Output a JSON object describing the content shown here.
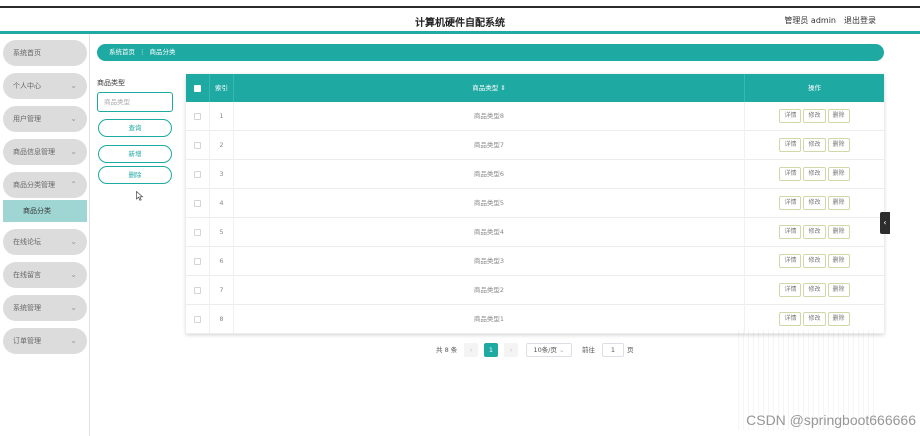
{
  "header": {
    "title": "计算机硬件自配系统",
    "user": "管理员 admin",
    "logout": "退出登录"
  },
  "sidebar": {
    "items": [
      {
        "label": "系统首页",
        "chev": ""
      },
      {
        "label": "个人中心",
        "chev": "⌄"
      },
      {
        "label": "用户管理",
        "chev": "⌄"
      },
      {
        "label": "商品信息管理",
        "chev": "⌄"
      },
      {
        "label": "商品分类管理",
        "chev": "⌃"
      },
      {
        "label": "在线论坛",
        "chev": "⌄"
      },
      {
        "label": "在线留言",
        "chev": "⌄"
      },
      {
        "label": "系统管理",
        "chev": "⌄"
      },
      {
        "label": "订单管理",
        "chev": "⌄"
      }
    ],
    "sub_active": "商品分类"
  },
  "breadcrumb": {
    "home": "系统首页",
    "sep": "⋮",
    "current": "商品分类"
  },
  "search": {
    "label": "商品类型",
    "placeholder": "商品类型",
    "query_btn": "查询",
    "add_btn": "新增",
    "delete_btn": "删除"
  },
  "table": {
    "headers": {
      "index": "索引",
      "type": "商品类型 ⇕",
      "ops": "操作"
    },
    "op_labels": {
      "detail": "详情",
      "edit": "修改",
      "delete": "删除"
    },
    "rows": [
      {
        "idx": "1",
        "type": "商品类型8"
      },
      {
        "idx": "2",
        "type": "商品类型7"
      },
      {
        "idx": "3",
        "type": "商品类型6"
      },
      {
        "idx": "4",
        "type": "商品类型5"
      },
      {
        "idx": "5",
        "type": "商品类型4"
      },
      {
        "idx": "6",
        "type": "商品类型3"
      },
      {
        "idx": "7",
        "type": "商品类型2"
      },
      {
        "idx": "8",
        "type": "商品类型1"
      }
    ]
  },
  "pagination": {
    "total": "共 8 条",
    "prev": "‹",
    "page": "1",
    "next": "›",
    "size": "10条/页",
    "size_chev": "⌄",
    "goto": "前往",
    "goto_val": "1",
    "page_suffix": "页"
  },
  "side_toggle": "‹",
  "watermark": "CSDN @springboot666666",
  "colors": {
    "accent": "#1fa9a3",
    "sidebar_item": "#dcdcdc",
    "sub_active": "#9fd6d3"
  }
}
